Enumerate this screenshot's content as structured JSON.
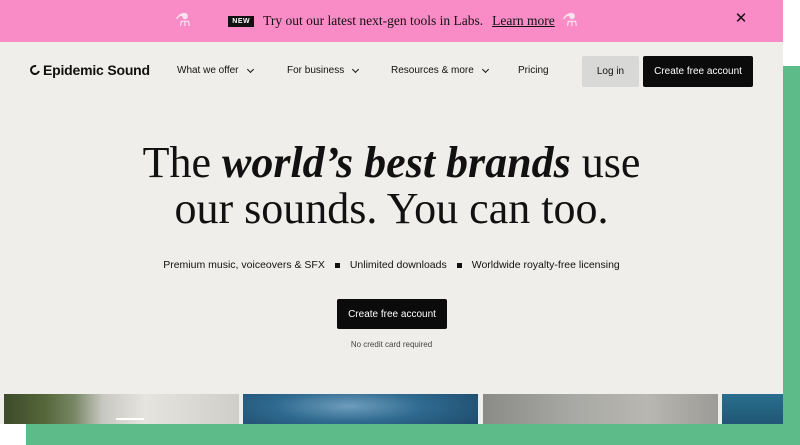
{
  "banner": {
    "badge": "NEW",
    "text": "Try out our latest next-gen tools in Labs.",
    "link": "Learn more",
    "close_icon": "close-icon",
    "background": "#f98bc6"
  },
  "nav": {
    "logo": "Epidemic Sound",
    "items": [
      {
        "label": "What we offer",
        "has_dropdown": true
      },
      {
        "label": "For business",
        "has_dropdown": true
      },
      {
        "label": "Resources & more",
        "has_dropdown": true
      },
      {
        "label": "Pricing",
        "has_dropdown": false
      }
    ],
    "login": "Log in",
    "create": "Create free account"
  },
  "hero": {
    "title_line1_pre": "The",
    "title_line1_em": "world’s best brands",
    "title_line1_post": "use",
    "title_line2": "our sounds. You can too.",
    "features": [
      "Premium music, voiceovers & SFX",
      "Unlimited downloads",
      "Worldwide royalty-free licensing"
    ],
    "cta": "Create free account",
    "note": "No credit card required"
  },
  "colors": {
    "accent_green": "#5dbb8a",
    "page_bg": "#efeeea",
    "button_dark": "#0b0b0b"
  }
}
